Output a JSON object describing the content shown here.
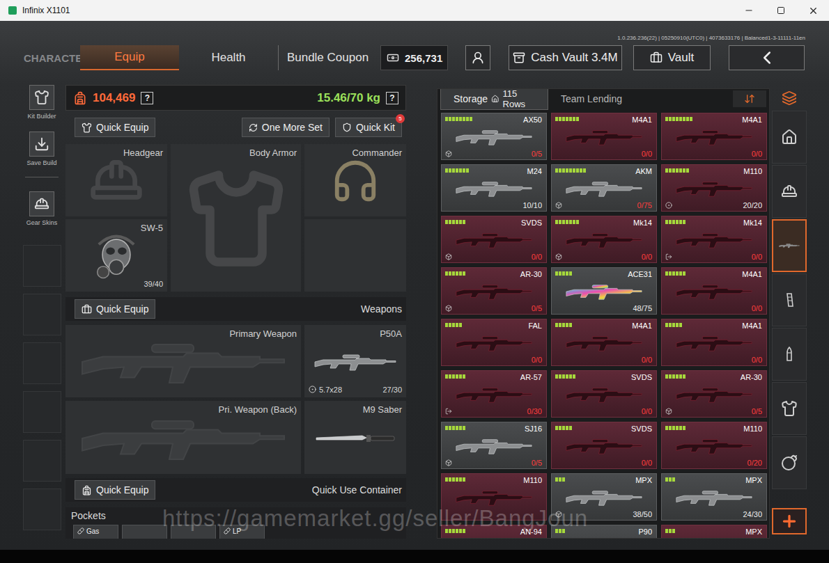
{
  "window": {
    "title": "Infinix X1101"
  },
  "version": "1.0.236.236(22) | 05250910(UTC0) | 4073633176 | Balanced1-3-11111-11en",
  "nav": {
    "section": "CHARACTER",
    "tabs": [
      {
        "label": "Equip",
        "selected": true
      },
      {
        "label": "Health",
        "selected": false
      },
      {
        "label": "Bundle Coupon",
        "selected": false
      }
    ],
    "money": "256,731",
    "cash_vault": "Cash Vault 3.4M",
    "vault": "Vault"
  },
  "sidebar": {
    "items": [
      {
        "label": "Kit Builder"
      },
      {
        "label": "Save Build"
      },
      {
        "label": "Gear Skins"
      }
    ]
  },
  "stats": {
    "value": "104,469",
    "weight": "15.46/70 kg",
    "help": "?"
  },
  "gear": {
    "quick_equip": "Quick Equip",
    "one_more_set": "One More Set",
    "quick_kit": "Quick Kit",
    "quick_kit_badge": "5",
    "slots": [
      {
        "label": "Headgear",
        "kind": "helmet",
        "filled": false,
        "count": null
      },
      {
        "label": "Body Armor",
        "kind": "armor",
        "filled": false,
        "count": null
      },
      {
        "label": "Commander",
        "kind": "headset",
        "filled": true,
        "count": null
      },
      {
        "label": "SW-5",
        "kind": "mask",
        "filled": true,
        "count": "39/40"
      }
    ]
  },
  "weapons": {
    "title": "Weapons",
    "quick_equip": "Quick Equip",
    "slots": [
      {
        "label": "Primary Weapon",
        "kind": "rifle",
        "filled": false,
        "ammo": null,
        "count": null
      },
      {
        "label": "P50A",
        "kind": "smg",
        "filled": true,
        "ammo": "5.7x28",
        "count": "27/30"
      },
      {
        "label": "Pri. Weapon (Back)",
        "kind": "rifle",
        "filled": false,
        "ammo": null,
        "count": null
      },
      {
        "label": "M9 Saber",
        "kind": "knife",
        "filled": true,
        "ammo": null,
        "count": null
      }
    ]
  },
  "quick_use": {
    "title": "Quick Use Container",
    "quick_equip": "Quick Equip"
  },
  "pockets": {
    "title": "Pockets",
    "slots": [
      {
        "label": "Gas"
      },
      {
        "label": null
      },
      {
        "label": null
      },
      {
        "label": "LP"
      }
    ]
  },
  "storage": {
    "tabs": [
      {
        "label": "Storage",
        "detail": "115 Rows",
        "selected": true
      },
      {
        "label": "Team Lending",
        "detail": null,
        "selected": false
      }
    ],
    "items": [
      {
        "name": "AX50",
        "pips": 8,
        "count": "0/5",
        "empty": true,
        "marked": false,
        "camo": false,
        "badge": "cube"
      },
      {
        "name": "M4A1",
        "pips": 7,
        "count": "0/0",
        "empty": true,
        "marked": true,
        "camo": false,
        "badge": "none"
      },
      {
        "name": "M4A1",
        "pips": 8,
        "count": "0/0",
        "empty": true,
        "marked": true,
        "camo": false,
        "badge": "none"
      },
      {
        "name": "M24",
        "pips": 7,
        "count": "10/10",
        "empty": false,
        "marked": false,
        "camo": false,
        "badge": "none"
      },
      {
        "name": "AKM",
        "pips": 9,
        "count": "0/75",
        "empty": true,
        "marked": false,
        "camo": false,
        "badge": "cube"
      },
      {
        "name": "M110",
        "pips": 7,
        "count": "20/20",
        "empty": false,
        "marked": true,
        "camo": false,
        "badge": "circle"
      },
      {
        "name": "SVDS",
        "pips": 6,
        "count": "0/0",
        "empty": true,
        "marked": true,
        "camo": false,
        "badge": "cube"
      },
      {
        "name": "Mk14",
        "pips": 7,
        "count": "0/0",
        "empty": true,
        "marked": true,
        "camo": false,
        "badge": "cube"
      },
      {
        "name": "Mk14",
        "pips": 6,
        "count": "0/0",
        "empty": true,
        "marked": true,
        "camo": false,
        "badge": "exit"
      },
      {
        "name": "AR-30",
        "pips": 6,
        "count": "0/5",
        "empty": true,
        "marked": true,
        "camo": false,
        "badge": "cube"
      },
      {
        "name": "ACE31",
        "pips": 5,
        "count": "48/75",
        "empty": false,
        "marked": false,
        "camo": true,
        "badge": "none"
      },
      {
        "name": "M4A1",
        "pips": 6,
        "count": "0/0",
        "empty": true,
        "marked": true,
        "camo": false,
        "badge": "none"
      },
      {
        "name": "FAL",
        "pips": 5,
        "count": "0/0",
        "empty": true,
        "marked": true,
        "camo": false,
        "badge": "none"
      },
      {
        "name": "M4A1",
        "pips": 5,
        "count": "0/0",
        "empty": true,
        "marked": true,
        "camo": false,
        "badge": "none"
      },
      {
        "name": "M4A1",
        "pips": 5,
        "count": "0/0",
        "empty": true,
        "marked": true,
        "camo": false,
        "badge": "none"
      },
      {
        "name": "AR-57",
        "pips": 6,
        "count": "0/30",
        "empty": true,
        "marked": true,
        "camo": false,
        "badge": "exit"
      },
      {
        "name": "SVDS",
        "pips": 6,
        "count": "0/0",
        "empty": true,
        "marked": true,
        "camo": false,
        "badge": "none"
      },
      {
        "name": "AR-30",
        "pips": 6,
        "count": "0/5",
        "empty": true,
        "marked": true,
        "camo": false,
        "badge": "cube"
      },
      {
        "name": "SJ16",
        "pips": 6,
        "count": "0/5",
        "empty": true,
        "marked": false,
        "camo": false,
        "badge": "cube"
      },
      {
        "name": "SVDS",
        "pips": 5,
        "count": "0/0",
        "empty": true,
        "marked": true,
        "camo": false,
        "badge": "none"
      },
      {
        "name": "M110",
        "pips": 6,
        "count": "0/20",
        "empty": true,
        "marked": true,
        "camo": false,
        "badge": "none"
      },
      {
        "name": "M110",
        "pips": 6,
        "count": null,
        "empty": false,
        "marked": true,
        "camo": false,
        "badge": "none"
      },
      {
        "name": "MPX",
        "pips": 3,
        "count": "38/50",
        "empty": false,
        "marked": false,
        "camo": false,
        "badge": "cube"
      },
      {
        "name": "MPX",
        "pips": 3,
        "count": "24/30",
        "empty": false,
        "marked": false,
        "camo": false,
        "badge": "none"
      },
      {
        "name": "AN-94",
        "pips": 6,
        "count": null,
        "empty": false,
        "marked": true,
        "camo": false,
        "badge": "none"
      },
      {
        "name": "P90",
        "pips": 3,
        "count": null,
        "empty": false,
        "marked": false,
        "camo": false,
        "badge": "none"
      },
      {
        "name": "MPX",
        "pips": 3,
        "count": null,
        "empty": false,
        "marked": true,
        "camo": false,
        "badge": "none"
      }
    ]
  },
  "categories": [
    {
      "kind": "home",
      "selected": false
    },
    {
      "kind": "helmet",
      "selected": false
    },
    {
      "kind": "weapon",
      "selected": true
    },
    {
      "kind": "magazine",
      "selected": false
    },
    {
      "kind": "ammo",
      "selected": false
    },
    {
      "kind": "armor",
      "selected": false
    },
    {
      "kind": "grenade",
      "selected": false
    }
  ],
  "watermark": "https://gamemarket.gg/seller/BangJoun"
}
